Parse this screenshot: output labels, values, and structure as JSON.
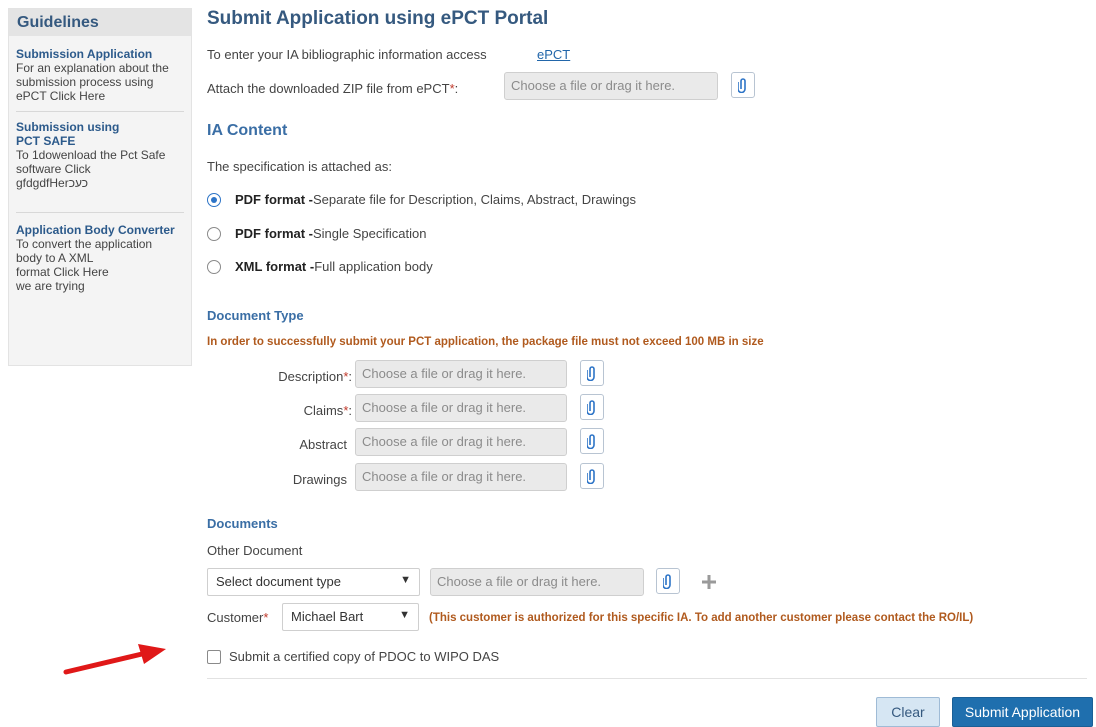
{
  "sidebar": {
    "title": "Guidelines",
    "items": [
      {
        "title": "Submission Application",
        "text": [
          "For an explanation about the",
          "submission process using",
          "ePCT Click Here"
        ]
      },
      {
        "title": "Submission using PCT SAFE",
        "text": [
          "To 1dowenload the Pct Safe",
          "software Click",
          "gfdgdfHerכעכ"
        ]
      },
      {
        "title": "Application Body Converter",
        "text": [
          "To convert the application",
          "body to A XML",
          "format Click Here",
          "we are trying"
        ]
      }
    ]
  },
  "main": {
    "title": "Submit Application using ePCT Portal",
    "bibliographic_text": "To enter your IA bibliographic information access",
    "epct_link": "ePCT",
    "zip_label": "Attach the downloaded ZIP file from ePCT",
    "required_mark": "*",
    "label_colon": ":",
    "file_placeholder": "Choose a file or drag it here.",
    "ia_content": {
      "title": "IA Content",
      "spec_text": "The specification is attached as:",
      "options": [
        {
          "bold": "PDF format -",
          "rest": "Separate file for Description, Claims, Abstract, Drawings",
          "checked": true
        },
        {
          "bold": "PDF format -",
          "rest": "Single Specification",
          "checked": false
        },
        {
          "bold": "XML format -",
          "rest": "Full application body",
          "checked": false
        }
      ]
    },
    "document_type": {
      "title": "Document Type",
      "warning": "In order to successfully submit your PCT application, the package file must not exceed 100 MB in size",
      "fields": [
        {
          "label": "Description",
          "required": true
        },
        {
          "label": "Claims",
          "required": true
        },
        {
          "label": "Abstract",
          "required": false
        },
        {
          "label": "Drawings",
          "required": false
        }
      ]
    },
    "documents": {
      "title": "Documents",
      "other_label": "Other Document",
      "select_value": "Select document type",
      "customer_label": "Customer",
      "customer_value": "Michael Bart",
      "customer_note": "(This customer is authorized for this specific IA. To add another customer please contact the RO/IL)"
    },
    "certified_copy": "Submit a certified copy of PDOC to WIPO DAS",
    "buttons": {
      "clear": "Clear",
      "submit": "Submit Application"
    },
    "icons": {
      "attach": "paperclip-icon",
      "add": "plus-icon",
      "caret": "▼"
    },
    "colors": {
      "accent": "#1f6fae",
      "heading": "#35597f",
      "warning": "#b05a1e",
      "arrow": "#e01818"
    }
  }
}
